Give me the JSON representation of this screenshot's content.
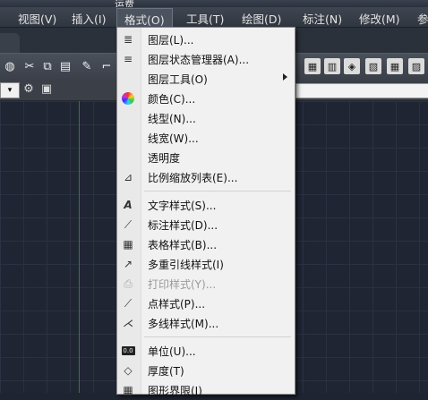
{
  "title": "运费",
  "menubar": {
    "items": [
      {
        "label": "视图(V)"
      },
      {
        "label": "插入(I)"
      },
      {
        "label": "格式(O)"
      },
      {
        "label": "工具(T)"
      },
      {
        "label": "绘图(D)"
      },
      {
        "label": "标注(N)"
      },
      {
        "label": "修改(M)"
      },
      {
        "label": "参"
      }
    ]
  },
  "format_menu": {
    "items": [
      {
        "label": "图层(L)...",
        "icon": "layer-icon"
      },
      {
        "label": "图层状态管理器(A)...",
        "icon": "layer-state-icon"
      },
      {
        "label": "图层工具(O)",
        "icon": "none",
        "submenu": true
      },
      {
        "label": "颜色(C)...",
        "icon": "color-wheel-icon"
      },
      {
        "label": "线型(N)...",
        "icon": "none"
      },
      {
        "label": "线宽(W)...",
        "icon": "none"
      },
      {
        "label": "透明度",
        "icon": "none"
      },
      {
        "label": "比例缩放列表(E)...",
        "icon": "scale-list-icon"
      },
      {
        "label": "文字样式(S)...",
        "icon": "text-style-icon"
      },
      {
        "label": "标注样式(D)...",
        "icon": "dimension-style-icon"
      },
      {
        "label": "表格样式(B)...",
        "icon": "table-style-icon"
      },
      {
        "label": "多重引线样式(I)",
        "icon": "multileader-style-icon"
      },
      {
        "label": "打印样式(Y)...",
        "icon": "plot-style-icon",
        "disabled": true
      },
      {
        "label": "点样式(P)...",
        "icon": "point-style-icon"
      },
      {
        "label": "多线样式(M)...",
        "icon": "multiline-style-icon"
      },
      {
        "label": "单位(U)...",
        "icon": "units-icon"
      },
      {
        "label": "厚度(T)",
        "icon": "thickness-icon"
      },
      {
        "label": "图形界限(I)",
        "icon": "drawing-limits-icon"
      }
    ]
  },
  "toolbar2": {
    "combo_value": ""
  },
  "colors": {
    "canvas": "#1f2533",
    "menu_bg": "#f1f1f1",
    "menubar_bg": "#3a414c",
    "active_menu": "#4b535f"
  }
}
